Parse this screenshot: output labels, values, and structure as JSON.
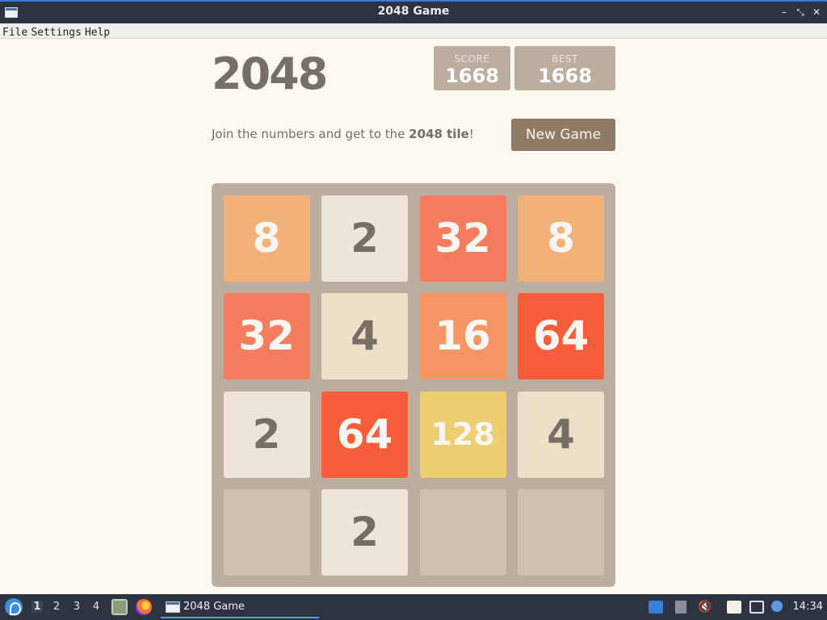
{
  "window": {
    "title": "2048 Game"
  },
  "menu": {
    "items": [
      "File",
      "Settings",
      "Help"
    ]
  },
  "game": {
    "title": "2048",
    "score_label": "SCORE",
    "score_value": "1668",
    "best_label": "BEST",
    "best_value": "1668",
    "intro_prefix": "Join the numbers and get to the ",
    "intro_bold": "2048 tile",
    "intro_suffix": "!",
    "new_game_label": "New Game"
  },
  "board": {
    "rows": [
      [
        "8",
        "2",
        "32",
        "8"
      ],
      [
        "32",
        "4",
        "16",
        "64"
      ],
      [
        "2",
        "64",
        "128",
        "4"
      ],
      [
        "",
        "2",
        "",
        ""
      ]
    ]
  },
  "tile_colors": {
    "2": {
      "bg": "#eee4da",
      "fg": "#776e65"
    },
    "4": {
      "bg": "#ede0c8",
      "fg": "#776e65"
    },
    "8": {
      "bg": "#f2b179",
      "fg": "#f9f6f2"
    },
    "16": {
      "bg": "#f59563",
      "fg": "#f9f6f2"
    },
    "32": {
      "bg": "#f67c5f",
      "fg": "#f9f6f2"
    },
    "64": {
      "bg": "#f65e3b",
      "fg": "#f9f6f2"
    },
    "128": {
      "bg": "#edcf72",
      "fg": "#f9f6f2"
    }
  },
  "taskbar": {
    "workspaces": [
      "1",
      "2",
      "3",
      "4"
    ],
    "active_workspace": "1",
    "window_button_label": "2048 Game",
    "clock": "14:34",
    "tray_icons": [
      "display-icon",
      "upload-icon",
      "volume-muted-icon",
      "clipboard-icon",
      "network-icon",
      "notification-icon"
    ]
  }
}
